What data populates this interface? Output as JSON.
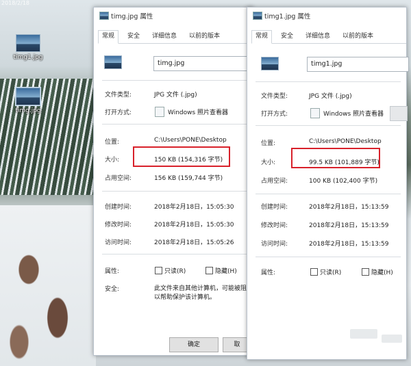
{
  "desktop": {
    "clock_text": "2018/2/18",
    "icons": [
      {
        "label": "timg1.jpg"
      },
      {
        "label": "timg.jpg"
      }
    ]
  },
  "dialog_left": {
    "title": "timg.jpg 属性",
    "tabs": [
      "常规",
      "安全",
      "详细信息",
      "以前的版本"
    ],
    "file_name": "timg.jpg",
    "file_type_label": "文件类型:",
    "file_type_value": "JPG 文件 (.jpg)",
    "open_with_label": "打开方式:",
    "open_with_value": "Windows 照片查看器",
    "location_label": "位置:",
    "location_value": "C:\\Users\\PONE\\Desktop",
    "size_label": "大小:",
    "size_value": "150 KB (154,316 字节)",
    "disk_size_label": "占用空间:",
    "disk_size_value": "156 KB (159,744 字节)",
    "created_label": "创建时间:",
    "created_value": "2018年2月18日，15:05:30",
    "modified_label": "修改时间:",
    "modified_value": "2018年2月18日，15:05:30",
    "accessed_label": "访问时间:",
    "accessed_value": "2018年2月18日，15:05:26",
    "attributes_label": "属性:",
    "readonly_label": "只读(R)",
    "hidden_label": "隐藏(H)",
    "security_label": "安全:",
    "security_text_line1": "此文件来自其他计算机，可能被阻",
    "security_text_line2": "以帮助保护该计算机。",
    "ok_label": "确定",
    "cancel_label": "取"
  },
  "dialog_right": {
    "title": "timg1.jpg 属性",
    "tabs": [
      "常规",
      "安全",
      "详细信息",
      "以前的版本"
    ],
    "file_name": "timg1.jpg",
    "file_type_label": "文件类型:",
    "file_type_value": "JPG 文件 (.jpg)",
    "open_with_label": "打开方式:",
    "open_with_value": "Windows 照片查看器",
    "location_label": "位置:",
    "location_value": "C:\\Users\\PONE\\Desktop",
    "size_label": "大小:",
    "size_value": "99.5 KB (101,889 字节)",
    "disk_size_label": "占用空间:",
    "disk_size_value": "100 KB (102,400 字节)",
    "created_label": "创建时间:",
    "created_value": "2018年2月18日，15:13:59",
    "modified_label": "修改时间:",
    "modified_value": "2018年2月18日，15:13:59",
    "accessed_label": "访问时间:",
    "accessed_value": "2018年2月18日，15:13:59",
    "attributes_label": "属性:",
    "readonly_label": "只读(R)",
    "hidden_label": "隐藏(H)"
  },
  "colors": {
    "highlight_box": "#d8202a"
  }
}
